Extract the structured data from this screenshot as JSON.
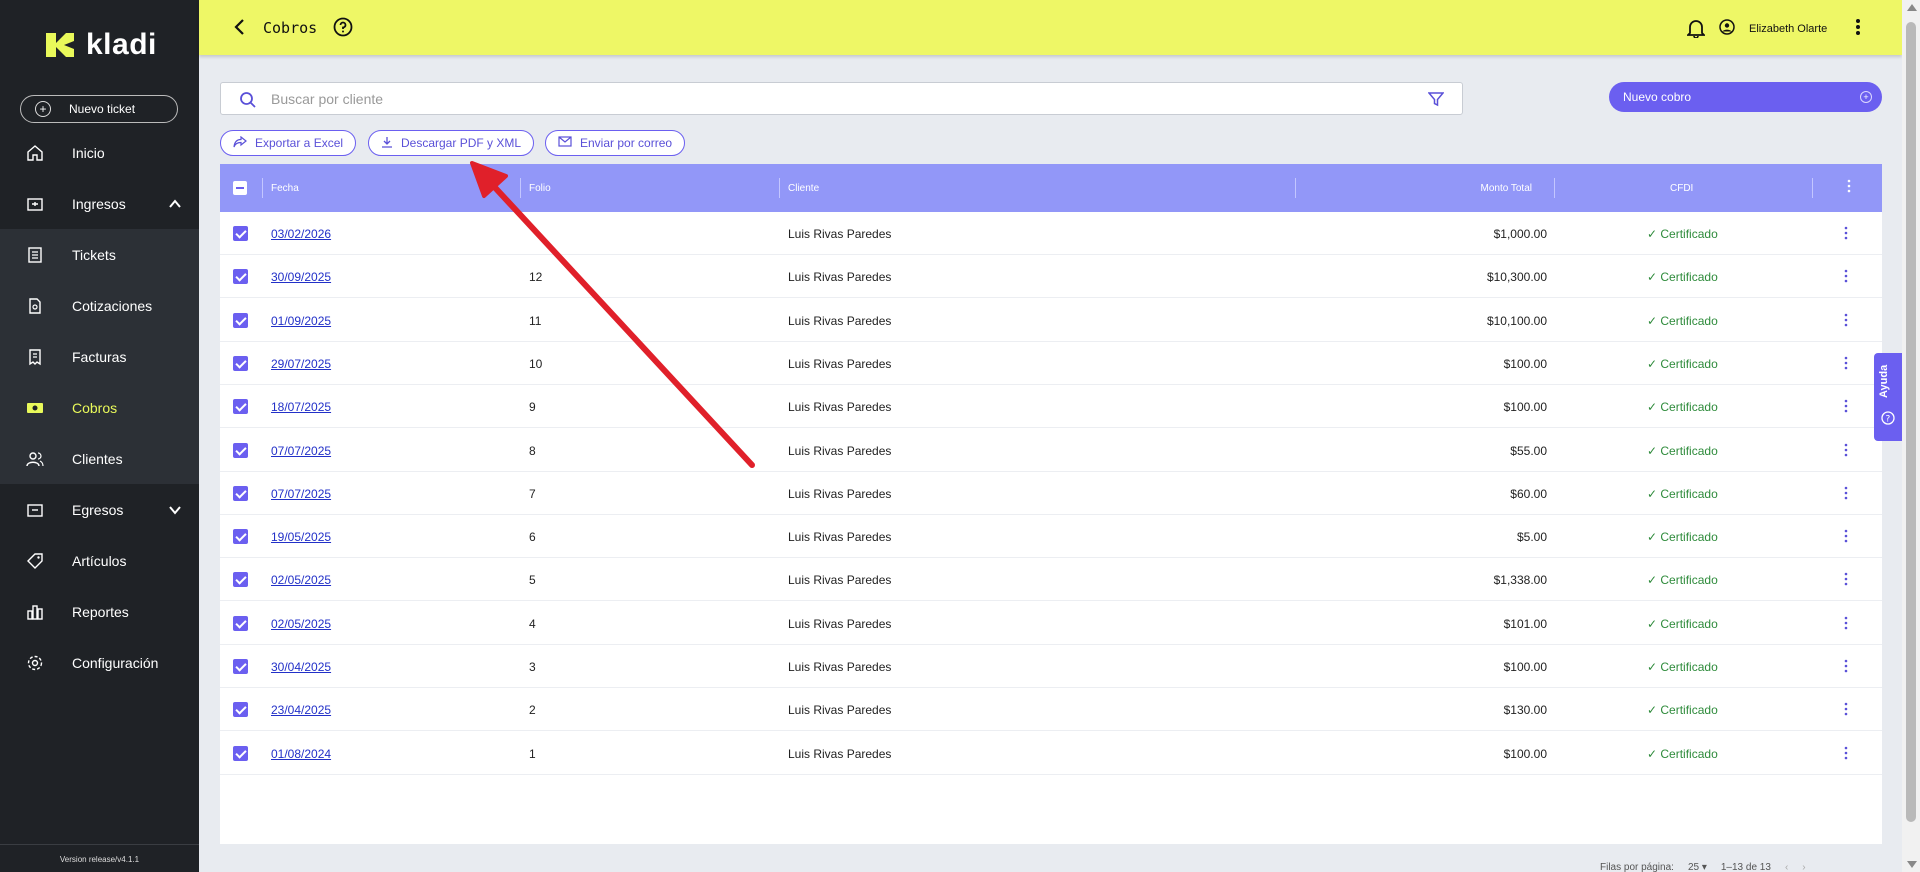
{
  "sidebar": {
    "logo_text": "kladi",
    "new_ticket": "Nuevo ticket",
    "items": [
      {
        "label": "Inicio",
        "icon": "home-icon"
      },
      {
        "label": "Ingresos",
        "icon": "income-icon"
      },
      {
        "label": "Tickets",
        "icon": "ticket-icon"
      },
      {
        "label": "Cotizaciones",
        "icon": "quote-icon"
      },
      {
        "label": "Facturas",
        "icon": "invoice-icon"
      },
      {
        "label": "Cobros",
        "icon": "payments-icon"
      },
      {
        "label": "Clientes",
        "icon": "clients-icon"
      },
      {
        "label": "Egresos",
        "icon": "expenses-icon"
      },
      {
        "label": "Artículos",
        "icon": "tag-icon"
      },
      {
        "label": "Reportes",
        "icon": "reports-icon"
      },
      {
        "label": "Configuración",
        "icon": "gear-icon"
      }
    ],
    "version": "Version release/v4.1.1"
  },
  "header": {
    "title": "Cobros",
    "user_name": "Elizabeth Olarte"
  },
  "search": {
    "placeholder": "Buscar por cliente"
  },
  "new_cobro_label": "Nuevo cobro",
  "actions": {
    "export_excel": "Exportar a Excel",
    "download_pdf_xml": "Descargar PDF y XML",
    "send_email": "Enviar por correo"
  },
  "table": {
    "columns": [
      "Fecha",
      "Folio",
      "Cliente",
      "Monto Total",
      "CFDI"
    ],
    "rows": [
      {
        "fecha": "03/02/2026",
        "folio": "",
        "cliente": "Luis Rivas Paredes",
        "monto": "$1,000.00",
        "cfdi": "Certificado"
      },
      {
        "fecha": "30/09/2025",
        "folio": "12",
        "cliente": "Luis Rivas Paredes",
        "monto": "$10,300.00",
        "cfdi": "Certificado"
      },
      {
        "fecha": "01/09/2025",
        "folio": "11",
        "cliente": "Luis Rivas Paredes",
        "monto": "$10,100.00",
        "cfdi": "Certificado"
      },
      {
        "fecha": "29/07/2025",
        "folio": "10",
        "cliente": "Luis Rivas Paredes",
        "monto": "$100.00",
        "cfdi": "Certificado"
      },
      {
        "fecha": "18/07/2025",
        "folio": "9",
        "cliente": "Luis Rivas Paredes",
        "monto": "$100.00",
        "cfdi": "Certificado"
      },
      {
        "fecha": "07/07/2025",
        "folio": "8",
        "cliente": "Luis Rivas Paredes",
        "monto": "$55.00",
        "cfdi": "Certificado"
      },
      {
        "fecha": "07/07/2025",
        "folio": "7",
        "cliente": "Luis Rivas Paredes",
        "monto": "$60.00",
        "cfdi": "Certificado"
      },
      {
        "fecha": "19/05/2025",
        "folio": "6",
        "cliente": "Luis Rivas Paredes",
        "monto": "$5.00",
        "cfdi": "Certificado"
      },
      {
        "fecha": "02/05/2025",
        "folio": "5",
        "cliente": "Luis Rivas Paredes",
        "monto": "$1,338.00",
        "cfdi": "Certificado"
      },
      {
        "fecha": "02/05/2025",
        "folio": "4",
        "cliente": "Luis Rivas Paredes",
        "monto": "$101.00",
        "cfdi": "Certificado"
      },
      {
        "fecha": "30/04/2025",
        "folio": "3",
        "cliente": "Luis Rivas Paredes",
        "monto": "$100.00",
        "cfdi": "Certificado"
      },
      {
        "fecha": "23/04/2025",
        "folio": "2",
        "cliente": "Luis Rivas Paredes",
        "monto": "$130.00",
        "cfdi": "Certificado"
      },
      {
        "fecha": "01/08/2024",
        "folio": "1",
        "cliente": "Luis Rivas Paredes",
        "monto": "$100.00",
        "cfdi": "Certificado"
      }
    ]
  },
  "footer": {
    "rows_per_page_label": "Filas por página:",
    "rows_per_page": "25",
    "range": "1–13 de 13"
  },
  "help_tab": "Ayuda",
  "colors": {
    "accent": "#6b5ff0",
    "header_bg": "#eef766",
    "sidebar_bg": "#1f2226",
    "table_head": "#9297f8",
    "success": "#2e8b3b",
    "annotation_arrow": "#e0202a"
  }
}
